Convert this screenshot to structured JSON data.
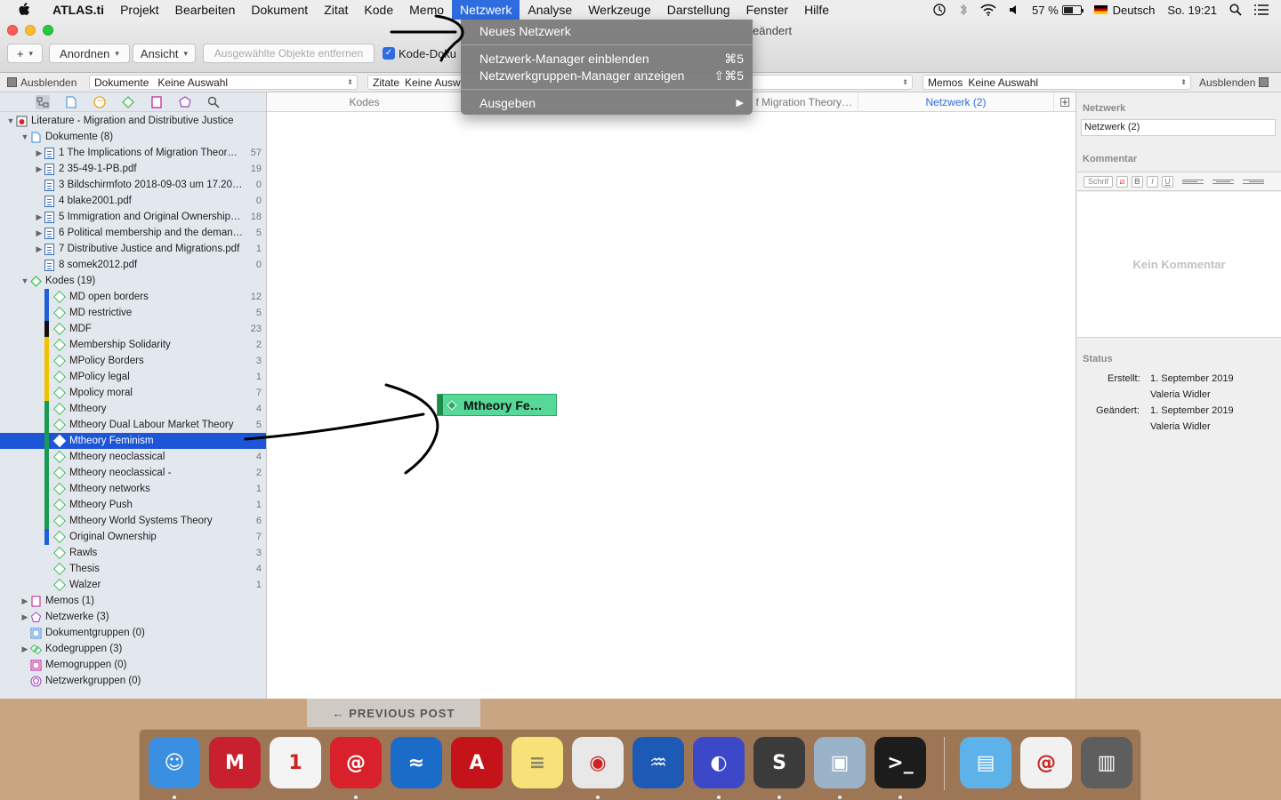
{
  "menubar": {
    "app": "ATLAS.ti",
    "items": [
      "Projekt",
      "Bearbeiten",
      "Dokument",
      "Zitat",
      "Kode",
      "Memo",
      "Netzwerk",
      "Analyse",
      "Werkzeuge",
      "Darstellung",
      "Fenster",
      "Hilfe"
    ],
    "active_item": "Netzwerk",
    "battery": "57 %",
    "battery_level": 0.57,
    "language": "Deutsch",
    "clock": "So. 19:21"
  },
  "window": {
    "title_fragment": "eändert",
    "toolbar": {
      "add_label": "+",
      "arrange_label": "Anordnen",
      "view_label": "Ansicht",
      "remove_label": "Ausgewählte Objekte entfernen",
      "checkbox_label": "Kode-Doku"
    },
    "filterbar": {
      "hide_left": "Ausblenden",
      "documents_label": "Dokumente",
      "documents_value": "Keine Auswahl",
      "quotes_label": "Zitate",
      "quotes_value": "Keine Ausw",
      "memos_label": "Memos",
      "memos_value": "Keine Auswahl",
      "hide_right": "Ausblenden"
    }
  },
  "tree": {
    "root": "Literature - Migration and Distributive Justice",
    "documents_header": "Dokumente (8)",
    "documents": [
      {
        "label": "1 The Implications of Migration Theor…",
        "count": "57",
        "expandable": true
      },
      {
        "label": "2 35-49-1-PB.pdf",
        "count": "19",
        "expandable": true
      },
      {
        "label": "3 Bildschirmfoto 2018-09-03 um 17.20…",
        "count": "0",
        "expandable": false
      },
      {
        "label": "4 blake2001.pdf",
        "count": "0",
        "expandable": false
      },
      {
        "label": "5 Immigration and Original Ownership…",
        "count": "18",
        "expandable": true
      },
      {
        "label": "6 Political membership and the deman…",
        "count": "5",
        "expandable": true
      },
      {
        "label": "7 Distributive Justice and Migrations.pdf",
        "count": "1",
        "expandable": true
      },
      {
        "label": "8 somek2012.pdf",
        "count": "0",
        "expandable": false
      }
    ],
    "codes_header": "Kodes (19)",
    "codes": [
      {
        "label": "MD open borders",
        "count": "12",
        "color": "#1f5fd8"
      },
      {
        "label": "MD restrictive",
        "count": "5",
        "color": "#1f5fd8"
      },
      {
        "label": "MDF",
        "count": "23",
        "color": "#111111"
      },
      {
        "label": "Membership Solidarity",
        "count": "2",
        "color": "#f2c200"
      },
      {
        "label": "MPolicy Borders",
        "count": "3",
        "color": "#f2c200"
      },
      {
        "label": "MPolicy legal",
        "count": "1",
        "color": "#f2c200"
      },
      {
        "label": "Mpolicy moral",
        "count": "7",
        "color": "#f2c200"
      },
      {
        "label": "Mtheory",
        "count": "4",
        "color": "#1a9a52"
      },
      {
        "label": "Mtheory Dual Labour Market Theory",
        "count": "5",
        "color": "#1a9a52"
      },
      {
        "label": "Mtheory Feminism",
        "count": "",
        "color": "#1a9a52",
        "selected": true
      },
      {
        "label": "Mtheory neoclassical",
        "count": "4",
        "color": "#1a9a52"
      },
      {
        "label": "Mtheory neoclassical -",
        "count": "2",
        "color": "#1a9a52"
      },
      {
        "label": "Mtheory networks",
        "count": "1",
        "color": "#1a9a52"
      },
      {
        "label": "Mtheory Push",
        "count": "1",
        "color": "#1a9a52"
      },
      {
        "label": "Mtheory World Systems Theory",
        "count": "6",
        "color": "#1a9a52"
      },
      {
        "label": "Original Ownership",
        "count": "7",
        "color": "#1f5fd8"
      },
      {
        "label": "Rawls",
        "count": "3",
        "color": ""
      },
      {
        "label": "Thesis",
        "count": "4",
        "color": ""
      },
      {
        "label": "Walzer",
        "count": "1",
        "color": ""
      }
    ],
    "groups": [
      {
        "label": "Memos (1)",
        "expandable": true,
        "icon": "memo-icon"
      },
      {
        "label": "Netzwerke (3)",
        "expandable": true,
        "icon": "network-icon"
      },
      {
        "label": "Dokumentgruppen (0)",
        "expandable": false,
        "icon": "document-group-icon"
      },
      {
        "label": "Kodegruppen (3)",
        "expandable": true,
        "icon": "code-group-icon"
      },
      {
        "label": "Memogruppen (0)",
        "expandable": false,
        "icon": "memo-group-icon"
      },
      {
        "label": "Netzwerkgruppen (0)",
        "expandable": false,
        "icon": "network-group-icon"
      }
    ]
  },
  "tabs": [
    {
      "label": "Kodes",
      "active": false
    },
    {
      "label": "f Migration Theory…",
      "active": false
    },
    {
      "label": "Netzwerk (2)",
      "active": true
    }
  ],
  "canvas": {
    "node_label": "Mtheory Fe…"
  },
  "inspector": {
    "network_heading": "Netzwerk",
    "network_name": "Netzwerk (2)",
    "comment_heading": "Kommentar",
    "font_button": "Schrif",
    "bold": "B",
    "italic": "I",
    "underline": "U",
    "no_comment": "Kein Kommentar",
    "status_heading": "Status",
    "created_label": "Erstellt:",
    "created_date": "1. September 2019",
    "created_by": "Valeria Widler",
    "modified_label": "Geändert:",
    "modified_date": "1. September 2019",
    "modified_by": "Valeria Widler"
  },
  "dropdown": {
    "items": [
      {
        "label": "Neues Netzwerk",
        "shortcut": ""
      },
      {
        "label": "Netzwerk-Manager einblenden",
        "shortcut": "⌘5"
      },
      {
        "label": "Netzwerkgruppen-Manager anzeigen",
        "shortcut": "⇧⌘5"
      },
      {
        "label": "Ausgeben",
        "shortcut": "▶"
      }
    ]
  },
  "desktop": {
    "blog_nav": "← PREVIOUS POST"
  },
  "dock": {
    "apps": [
      {
        "name": "finder",
        "color": "#3b8fe0",
        "glyph": "☺",
        "running": true
      },
      {
        "name": "mendeley",
        "color": "#c9202f",
        "glyph": "M",
        "running": false
      },
      {
        "name": "calendar",
        "color": "#f4f4f4",
        "glyph": "1",
        "running": false
      },
      {
        "name": "atlas-ti",
        "color": "#d8212a",
        "glyph": "@",
        "running": true
      },
      {
        "name": "openoffice",
        "color": "#1b6bc8",
        "glyph": "≈",
        "running": false
      },
      {
        "name": "acrobat",
        "color": "#c4141a",
        "glyph": "A",
        "running": false
      },
      {
        "name": "notes",
        "color": "#f7e27a",
        "glyph": "≡",
        "running": false
      },
      {
        "name": "chrome",
        "color": "#e8e8e8",
        "glyph": "◉",
        "running": true
      },
      {
        "name": "audio-app",
        "color": "#1d5ab5",
        "glyph": "♒",
        "running": false
      },
      {
        "name": "firefox",
        "color": "#3c48c8",
        "glyph": "◐",
        "running": true
      },
      {
        "name": "sublime",
        "color": "#3b3b3b",
        "glyph": "S",
        "running": true
      },
      {
        "name": "preview",
        "color": "#9bb3c9",
        "glyph": "▣",
        "running": true
      },
      {
        "name": "terminal",
        "color": "#1c1c1c",
        "glyph": ">_",
        "running": true
      },
      {
        "name": "downloads-folder",
        "color": "#5db2ea",
        "glyph": "▤",
        "running": false
      },
      {
        "name": "atlas-document",
        "color": "#f1f1f1",
        "glyph": "@",
        "running": false
      },
      {
        "name": "trash",
        "color": "#5e5e5e",
        "glyph": "▥",
        "running": false
      }
    ]
  }
}
